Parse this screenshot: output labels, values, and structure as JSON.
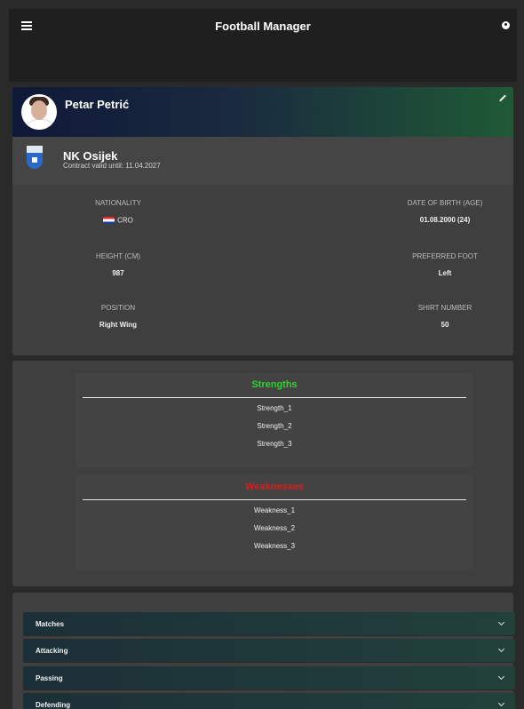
{
  "appbar": {
    "title": "Football Manager",
    "icons": [
      "menu-icon",
      "account-icon"
    ]
  },
  "player": {
    "name": "Petar Petrić",
    "club": {
      "name": "NK Osijek",
      "contract": "Contract valid until: 11.04.2027"
    },
    "info": {
      "nationality_label": "NATIONALITY",
      "nationality_value": "CRO",
      "dob_label": "DATE OF BIRTH (AGE)",
      "dob_value": "01.08.2000 (24)",
      "height_label": "HEIGHT (CM)",
      "height_value": "987",
      "foot_label": "PREFERRED FOOT",
      "foot_value": "Left",
      "position_label": "POSITION",
      "position_value": "Right Wing",
      "shirt_label": "SHIRT NUMBER",
      "shirt_value": "50"
    }
  },
  "strengths": {
    "title": "Strengths",
    "items": [
      "Strength_1",
      "Strength_2",
      "Strength_3"
    ]
  },
  "weaknesses": {
    "title": "Weaknesses",
    "items": [
      "Weakness_1",
      "Weakness_2",
      "Weakness_3"
    ]
  },
  "stats_sections": [
    "Matches",
    "Attacking",
    "Passing",
    "Defending"
  ],
  "colors": {
    "strength": "#2ed32e",
    "weakness": "#d41f1f",
    "background": "#2a2a2a",
    "card": "#3f3f3f"
  }
}
